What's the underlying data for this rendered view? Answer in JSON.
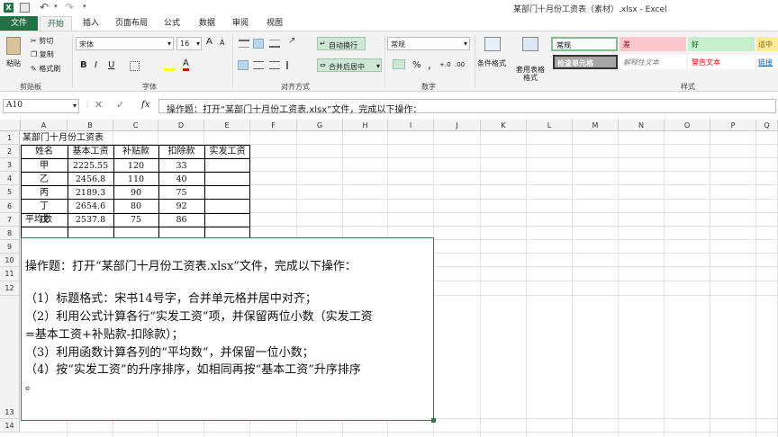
{
  "title_bar": {
    "title": "某部门十月份工资表（素材）.xlsx - Excel"
  },
  "tabs": [
    "文件",
    "开始",
    "插入",
    "页面布局",
    "公式",
    "数据",
    "审阅",
    "视图"
  ],
  "clipboard": {
    "paste": "粘贴",
    "cut": "剪切",
    "copy": "复制",
    "format_painter": "格式刷",
    "group": "剪贴板"
  },
  "font": {
    "name": "宋体",
    "size": "16",
    "bold": "B",
    "italic": "I",
    "underline": "U",
    "grow": "A",
    "shrink": "A",
    "group": "字体"
  },
  "alignment": {
    "wrap": "自动换行",
    "merge": "合并后居中",
    "group": "对齐方式"
  },
  "number": {
    "format": "常规",
    "currency": "%",
    "percent": "%",
    "comma": ",",
    "group": "数字"
  },
  "styles_group": {
    "conditional": "条件格式",
    "table_format": "套用表格格式",
    "group": "样式",
    "styles": [
      {
        "label": "常规",
        "bg": "#ffffff",
        "fg": "#000000"
      },
      {
        "label": "差",
        "bg": "#ffc7ce",
        "fg": "#9c0006"
      },
      {
        "label": "好",
        "bg": "#c6efce",
        "fg": "#006100"
      },
      {
        "label": "适中",
        "bg": "#ffeb9c",
        "fg": "#9c6500"
      },
      {
        "label": "检查单元格",
        "bg": "#a5a5a5",
        "fg": "#ffffff"
      },
      {
        "label": "解释性文本",
        "bg": "#ffffff",
        "fg": "#7f7f7f"
      },
      {
        "label": "警告文本",
        "bg": "#ffffff",
        "fg": "#ff0000"
      },
      {
        "label": "链接",
        "bg": "#ffffff",
        "fg": "#0563c1"
      }
    ]
  },
  "formula_bar": {
    "name_box": "A10",
    "fx": "fx",
    "content": "操作题：打开“某部门十月份工资表.xlsx”文件，完成以下操作："
  },
  "columns": [
    "A",
    "B",
    "C",
    "D",
    "E",
    "F",
    "G",
    "H",
    "I",
    "J",
    "K",
    "L",
    "M",
    "N",
    "O",
    "P",
    "Q"
  ],
  "rows": [
    "1",
    "2",
    "3",
    "4",
    "5",
    "6",
    "7",
    "8",
    "9",
    "10",
    "11",
    "12",
    "13",
    "14"
  ],
  "sheet": {
    "a1": "某部门十月份工资表",
    "headers": [
      "姓名",
      "基本工资",
      "补贴款",
      "扣除款",
      "实发工资"
    ],
    "data": [
      [
        "甲",
        "2225.55",
        "120",
        "33",
        ""
      ],
      [
        "乙",
        "2456.8",
        "110",
        "40",
        ""
      ],
      [
        "丙",
        "2189.3",
        "90",
        "75",
        ""
      ],
      [
        "丁",
        "2654.6",
        "80",
        "92",
        ""
      ],
      [
        "戊",
        "2537.8",
        "75",
        "86",
        ""
      ]
    ],
    "avg_label": "平均数"
  },
  "textbox": {
    "lines": [
      "操作题：打开“某部门十月份工资表.xlsx”文件，完成以下操作：",
      "（1）标题格式：宋书14号字，合并单元格并居中对齐；",
      "（2）利用公式计算各行“实发工资”项，并保留两位小数（实发工资",
      "=基本工资+补贴款-扣除款）；",
      "（3）利用函数计算各列的“平均数”，并保留一位小数；",
      "（4）按“实发工资”的升序排序，如相同再按“基本工资”升序排序",
      "。"
    ]
  }
}
